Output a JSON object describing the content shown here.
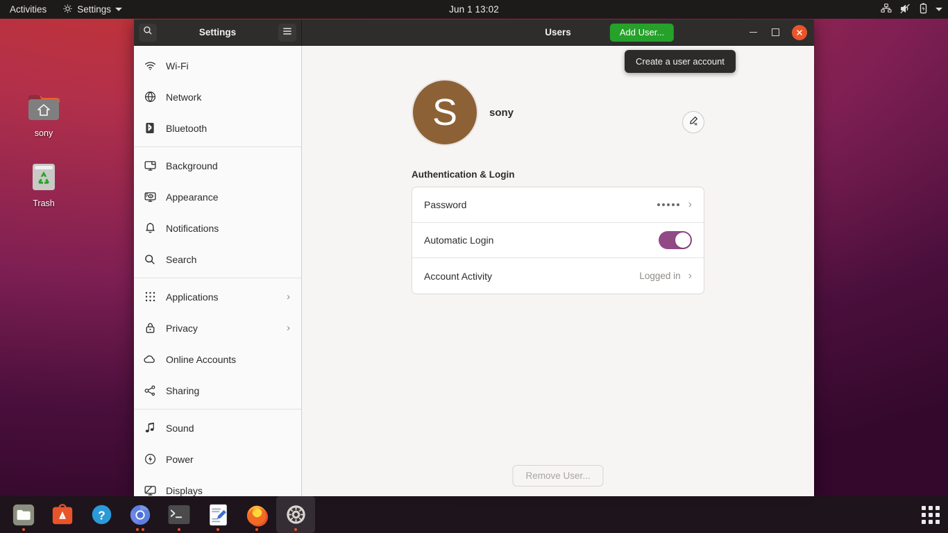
{
  "topbar": {
    "activities": "Activities",
    "app_menu": "Settings",
    "app_menu_icon": "gear-icon",
    "clock": "Jun 1  13:02",
    "status_icons": [
      "network-wired-icon",
      "volume-muted-icon",
      "battery-charging-icon",
      "caret-down-icon"
    ]
  },
  "desktop": {
    "icons": [
      {
        "label": "sony",
        "icon": "home-folder-icon"
      },
      {
        "label": "Trash",
        "icon": "trash-icon"
      }
    ]
  },
  "window": {
    "sidebar_title": "Settings",
    "page_title": "Users",
    "search_icon": "search-icon",
    "menu_icon": "hamburger-menu-icon",
    "add_user_label": "Add User...",
    "tooltip": "Create a user account",
    "controls": {
      "minimize": "minimize-icon",
      "maximize": "maximize-icon",
      "close": "close-icon"
    }
  },
  "sidebar": {
    "groups": [
      {
        "items": [
          {
            "label": "Wi-Fi",
            "icon": "wifi-icon",
            "chevron": false
          },
          {
            "label": "Network",
            "icon": "globe-icon",
            "chevron": false
          },
          {
            "label": "Bluetooth",
            "icon": "bluetooth-icon",
            "chevron": false
          }
        ]
      },
      {
        "items": [
          {
            "label": "Background",
            "icon": "background-icon",
            "chevron": false
          },
          {
            "label": "Appearance",
            "icon": "appearance-icon",
            "chevron": false
          },
          {
            "label": "Notifications",
            "icon": "bell-icon",
            "chevron": false
          },
          {
            "label": "Search",
            "icon": "search-icon",
            "chevron": false
          }
        ]
      },
      {
        "items": [
          {
            "label": "Applications",
            "icon": "apps-grid-icon",
            "chevron": true
          },
          {
            "label": "Privacy",
            "icon": "lock-icon",
            "chevron": true
          },
          {
            "label": "Online Accounts",
            "icon": "cloud-icon",
            "chevron": false
          },
          {
            "label": "Sharing",
            "icon": "share-icon",
            "chevron": false
          }
        ]
      },
      {
        "items": [
          {
            "label": "Sound",
            "icon": "music-note-icon",
            "chevron": false
          },
          {
            "label": "Power",
            "icon": "power-icon",
            "chevron": false
          },
          {
            "label": "Displays",
            "icon": "display-icon",
            "chevron": false
          }
        ]
      }
    ]
  },
  "main": {
    "user": {
      "avatar_initial": "S",
      "avatar_color": "#8d6136",
      "name": "sony",
      "edit_icon": "pencil-icon"
    },
    "section_title": "Authentication & Login",
    "rows": [
      {
        "label": "Password",
        "value": "•••••",
        "kind": "password",
        "chevron": true
      },
      {
        "label": "Automatic Login",
        "value": "on",
        "kind": "toggle",
        "chevron": false
      },
      {
        "label": "Account Activity",
        "value": "Logged in",
        "kind": "value",
        "chevron": true
      }
    ],
    "remove_user_label": "Remove User...",
    "remove_user_enabled": false
  },
  "dock": {
    "items": [
      {
        "name": "files",
        "icon": "files-icon",
        "dots": 1,
        "active": false
      },
      {
        "name": "ubuntu-software",
        "icon": "ubuntu-software-icon",
        "dots": 0,
        "active": false
      },
      {
        "name": "help",
        "icon": "help-icon",
        "dots": 0,
        "active": false
      },
      {
        "name": "chromium",
        "icon": "chromium-icon",
        "dots": 2,
        "active": false
      },
      {
        "name": "terminal",
        "icon": "terminal-icon",
        "dots": 1,
        "active": false
      },
      {
        "name": "text-editor",
        "icon": "text-editor-icon",
        "dots": 1,
        "active": false
      },
      {
        "name": "firefox",
        "icon": "firefox-icon",
        "dots": 1,
        "active": false
      },
      {
        "name": "settings",
        "icon": "gear-icon",
        "dots": 1,
        "active": true
      }
    ],
    "show_apps_icon": "apps-grid-icon"
  },
  "colors": {
    "accent_green": "#26a12a",
    "close_orange": "#e9552a",
    "toggle_purple": "#924A87",
    "dock_indicator": "#e95420"
  }
}
